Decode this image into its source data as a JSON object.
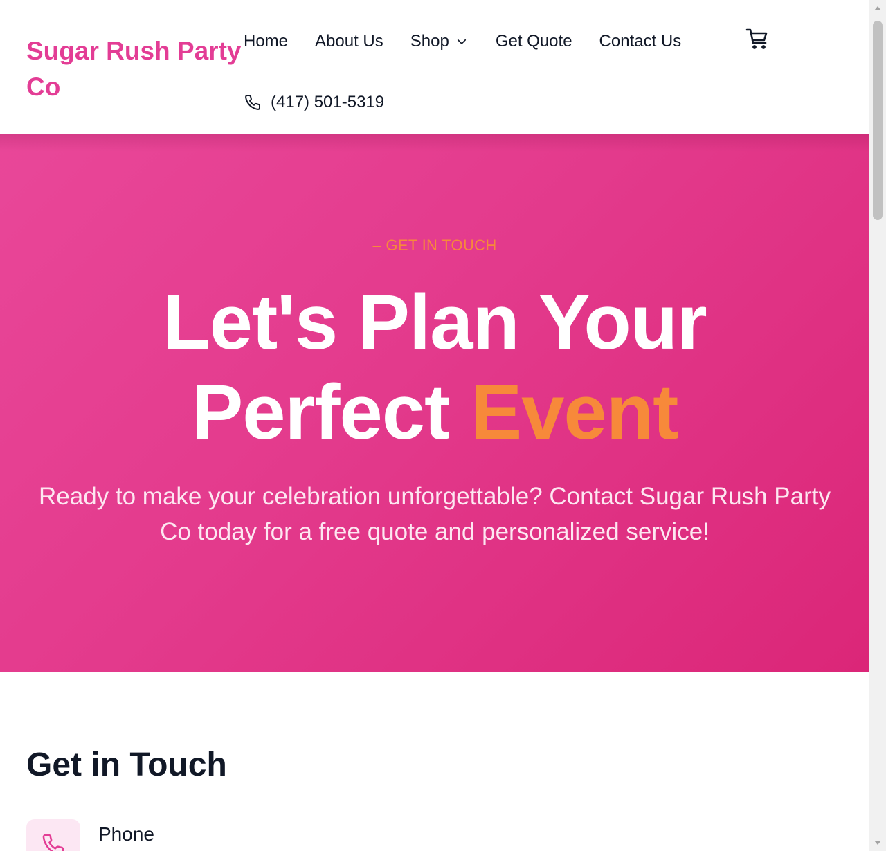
{
  "header": {
    "brand": "Sugar Rush Party Co",
    "nav": [
      {
        "label": "Home"
      },
      {
        "label": "About Us"
      },
      {
        "label": "Shop"
      },
      {
        "label": "Get Quote"
      },
      {
        "label": "Contact Us"
      }
    ],
    "phone": "(417) 501-5319",
    "icons": {
      "shop_dropdown": "chevron-down-icon",
      "cart": "cart-icon",
      "phone": "phone-icon"
    }
  },
  "hero": {
    "eyebrow": "– GET IN TOUCH",
    "title_line1": "Let's Plan Your",
    "title_line2_main": "Perfect ",
    "title_line2_accent": "Event",
    "subtitle": "Ready to make your celebration unforgettable? Contact Sugar Rush Party Co today for a free quote and personalized service!"
  },
  "contact": {
    "title": "Get in Touch",
    "items": [
      {
        "label": "Phone",
        "icon": "phone-icon"
      }
    ]
  },
  "colors": {
    "brand_pink": "#e33d95",
    "hero_gradient_start": "#e94799",
    "hero_gradient_end": "#db2678",
    "accent_orange": "#f7893a",
    "icon_box_bg": "#fce7f3"
  }
}
